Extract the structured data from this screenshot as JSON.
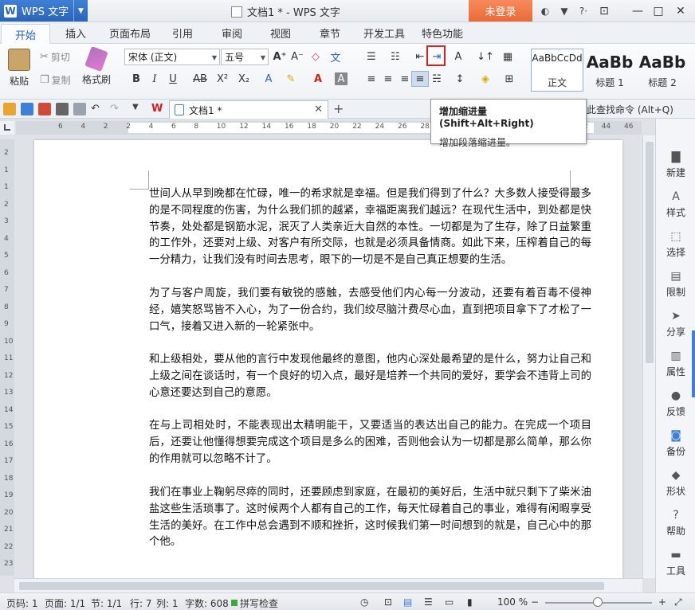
{
  "app": {
    "name": "WPS 文字",
    "title": "文档1 * - WPS 文字",
    "login": "未登录"
  },
  "tabs": [
    "开始",
    "插入",
    "页面布局",
    "引用",
    "审阅",
    "视图",
    "章节",
    "开发工具",
    "特色功能"
  ],
  "ribbon": {
    "paste": "粘贴",
    "cut": "剪切",
    "copy": "复制",
    "format_painter": "格式刷",
    "font": "宋体 (正文)",
    "size": "五号",
    "styles": [
      {
        "sample": "AaBbCcDd",
        "name": "正文"
      },
      {
        "sample": "AaBb",
        "name": "标题 1"
      },
      {
        "sample": "AaBb",
        "name": "标题 2"
      }
    ]
  },
  "doc_tab": "文档1 *",
  "find_command": "此查找命令 (Alt+Q)",
  "tooltip": {
    "title": "增加缩进量 (Shift+Alt+Right)",
    "desc": "增加段落缩进量。"
  },
  "ruler_h": [
    "6",
    "4",
    "2",
    "2",
    "4",
    "6",
    "8",
    "10",
    "12",
    "14",
    "16",
    "18",
    "20",
    "22",
    "24",
    "26",
    "28",
    "30",
    "32",
    "34",
    "36",
    "38",
    "40",
    "42",
    "44",
    "46"
  ],
  "ruler_v": [
    "2",
    "1",
    "1",
    "2",
    "3",
    "4",
    "5",
    "6",
    "7",
    "8",
    "9",
    "10",
    "11",
    "12",
    "13",
    "14",
    "15",
    "16",
    "17",
    "18",
    "19",
    "20",
    "21",
    "22",
    "23"
  ],
  "paragraphs": [
    "世间人从早到晚都在忙碌，唯一的希求就是幸福。但是我们得到了什么？大多数人接受得最多的是不同程度的伤害，为什么我们抓的越紧，幸福距离我们越远？在现代生活中，到处都是快节奏，处处都是钢筋水泥，泯灭了人类亲近大自然的本性。一切都是为了生存，除了日益繁重的工作外，还要对上级、对客户有所交际，也就是必须具备情商。如此下来，压榨着自己的每一分精力，让我们没有时间去思考，眼下的一切是不是自己真正想要的生活。",
    "为了与客户周旋，我们要有敏锐的感触，去感受他们内心每一分波动，还要有着百毒不侵神经，嬉笑怒骂皆不入心，为了一份合约，我们绞尽脑汁费尽心血，直到把项目拿下了才松了一口气，接着又进入新的一轮紧张中。",
    "和上级相处，要从他的言行中发现他最终的意图，他内心深处最希望的是什么，努力让自己和上级之间在谈话时，有一个良好的切入点，最好是培养一个共同的爱好，要学会不违背上司的心意还要达到自己的意愿。",
    "在与上司相处时，不能表现出太精明能干，又要适当的表达出自己的能力。在完成一个项目后，还要让他懂得想要完成这个项目是多么的困难，否则他会认为一切都是那么简单，那么你的作用就可以忽略不计了。",
    "我们在事业上鞠躬尽瘁的同时，还要顾虑到家庭，在最初的美好后，生活中就只剩下了柴米油盐这些生活琐事了。这时候两个人都有自己的工作，每天忙碌着自己的事业，难得有闲暇享受生活的美好。在工作中总会遇到不顺和挫折，这时候我们第一时间想到的就是，自己心中的那个他。"
  ],
  "side_panel": [
    "新建",
    "样式",
    "选择",
    "限制",
    "分享",
    "属性",
    "反馈",
    "备份",
    "形状",
    "帮助",
    "工具"
  ],
  "status": {
    "page": "页码: 1",
    "pages": "页面: 1/1",
    "section": "节: 1/1",
    "row": "行: 7",
    "col": "列: 1",
    "words": "字数: 608",
    "spell": "拼写检查",
    "zoom": "100 %"
  }
}
